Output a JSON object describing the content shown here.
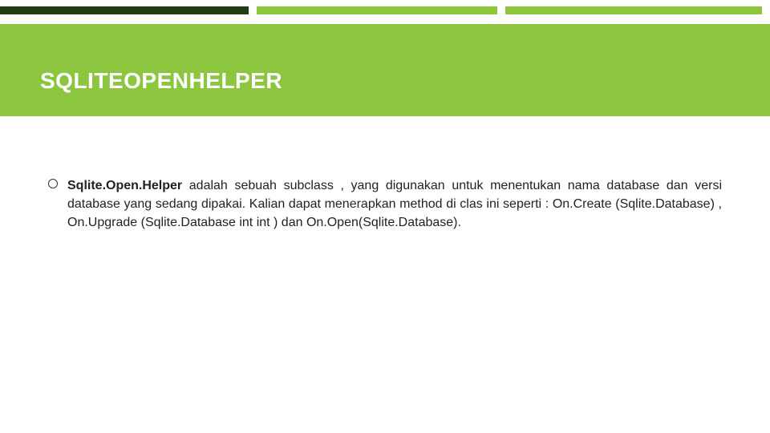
{
  "slide": {
    "title": "SQLITEOPENHELPER",
    "bullet": {
      "bold_lead": "Sqlite.Open.Helper",
      "rest": " adalah sebuah subclass , yang digunakan untuk menentukan nama database dan versi database yang sedang dipakai. Kalian dapat menerapkan method di clas ini seperti : On.Create (Sqlite.Database) , On.Upgrade (Sqlite.Database int int ) dan On.Open(Sqlite.Database)."
    }
  }
}
